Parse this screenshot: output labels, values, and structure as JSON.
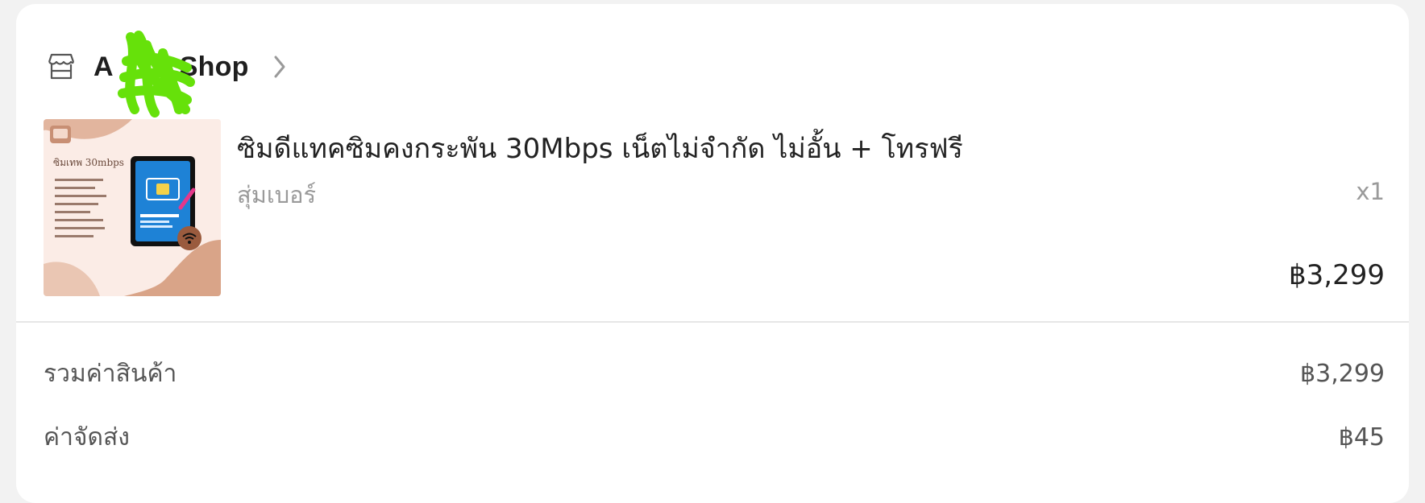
{
  "shop": {
    "name_prefix": "A",
    "name_suffix": "Shop",
    "icon": "store-icon",
    "chevron": "chevron-right-icon"
  },
  "product": {
    "thumbnail_text": "ซิมเทพ 30mbps",
    "title": "ซิมดีแทคซิมคงกระพัน 30Mbps เน็ตไม่จำกัด ไม่อั้น + โทรฟรี",
    "variant": "สุ่มเบอร์",
    "quantity": "x1",
    "price": "฿3,299"
  },
  "summary": {
    "subtotal_label": "รวมค่าสินค้า",
    "subtotal_value": "฿3,299",
    "shipping_label": "ค่าจัดส่ง",
    "shipping_value": "฿45"
  },
  "colors": {
    "scribble": "#66e10a",
    "thumbnail_bg": "#fbece6",
    "sim_blue": "#1e82d6"
  }
}
